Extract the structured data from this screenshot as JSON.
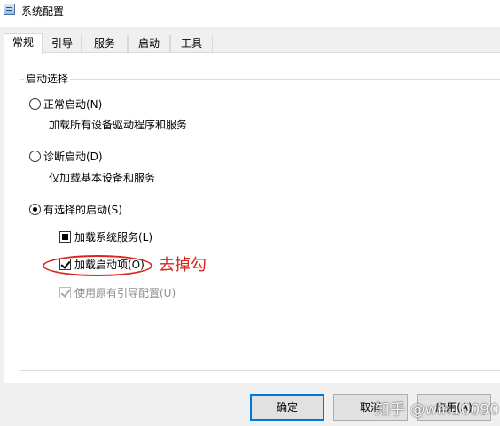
{
  "window": {
    "title": "系统配置"
  },
  "tabs": [
    {
      "label": "常规"
    },
    {
      "label": "引导"
    },
    {
      "label": "服务"
    },
    {
      "label": "启动"
    },
    {
      "label": "工具"
    }
  ],
  "startup_selection": {
    "group_title": "启动选择",
    "normal": {
      "label": "正常启动(N)",
      "desc": "加载所有设备驱动程序和服务",
      "checked": false
    },
    "diagnostic": {
      "label": "诊断启动(D)",
      "desc": "仅加载基本设备和服务",
      "checked": false
    },
    "selective": {
      "label": "有选择的启动(S)",
      "checked": true,
      "options": [
        {
          "label": "加载系统服务(L)",
          "state": "indeterminate"
        },
        {
          "label": "加载启动项(O)",
          "state": "checked"
        },
        {
          "label": "使用原有引导配置(U)",
          "state": "checked-disabled"
        }
      ]
    }
  },
  "annotation": {
    "text": "去掉勾",
    "color": "#d9261c"
  },
  "buttons": {
    "ok": "确定",
    "cancel": "取消",
    "apply": "应用(A)"
  },
  "watermark": {
    "text": "知乎 @win10090"
  },
  "colors": {
    "accent": "#0078d7",
    "panel_bg": "#ffffff",
    "window_bg": "#f0f0f0"
  }
}
